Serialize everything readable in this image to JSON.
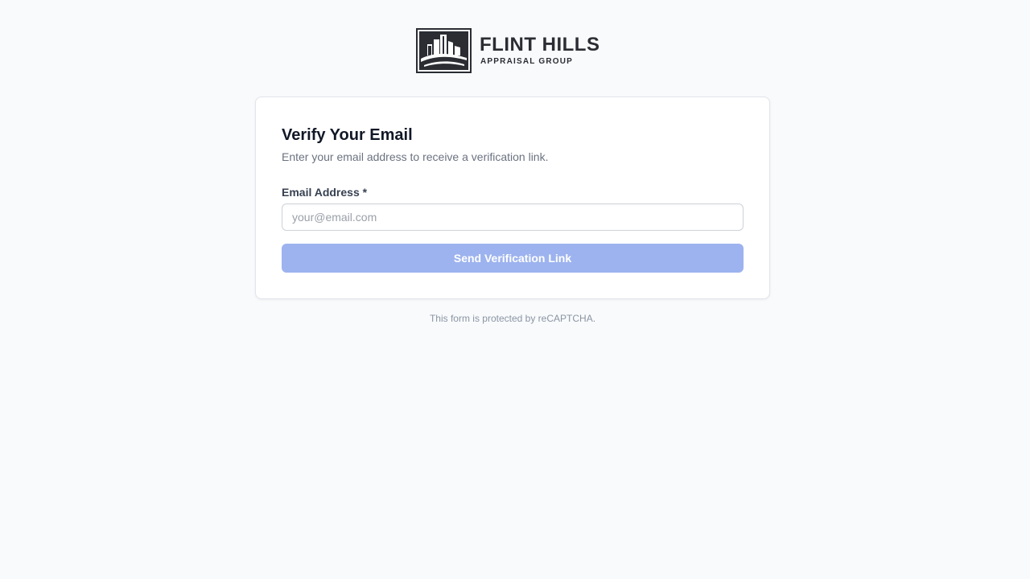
{
  "brand": {
    "name": "FLINT HILLS",
    "tagline": "APPRAISAL GROUP",
    "color": "#2b2d33"
  },
  "form": {
    "title": "Verify Your Email",
    "subtitle": "Enter your email address to receive a verification link.",
    "email_label": "Email Address *",
    "email_value": "",
    "email_placeholder": "your@email.com",
    "submit_label": "Send Verification Link",
    "submit_color": "#9db3ef"
  },
  "footer": {
    "recaptcha_note": "This form is protected by reCAPTCHA."
  }
}
